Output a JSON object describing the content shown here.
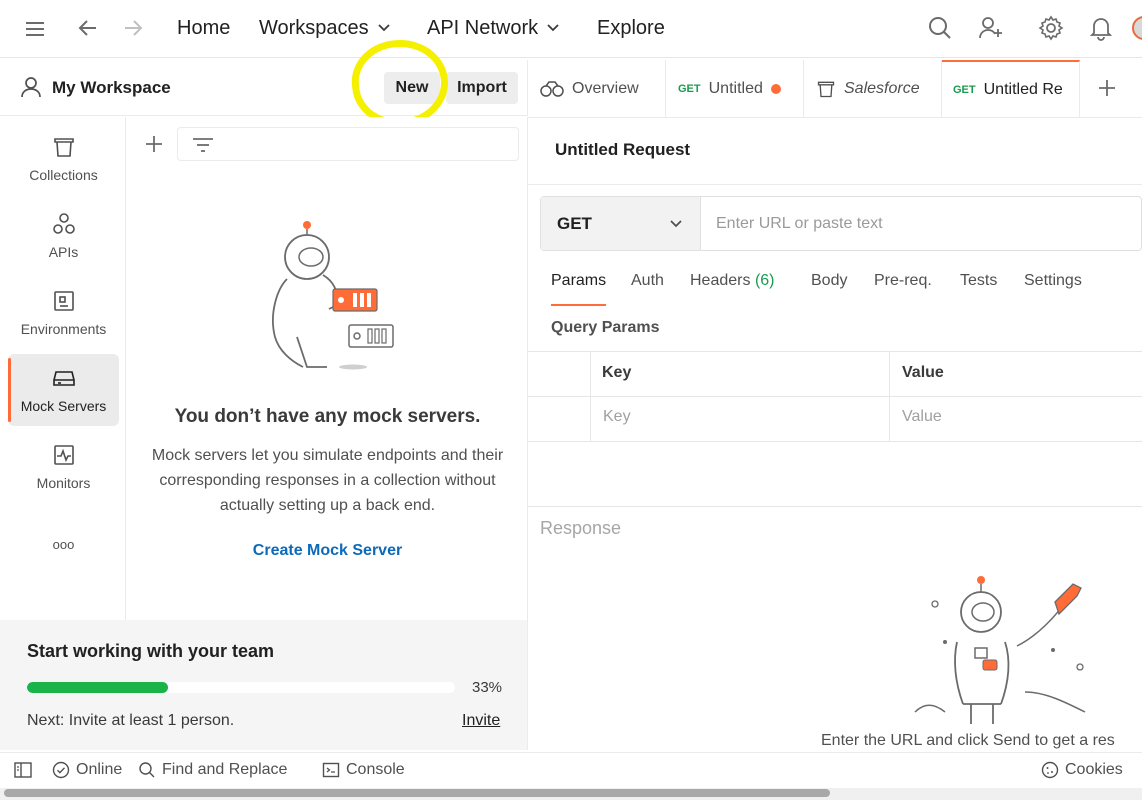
{
  "topbar": {
    "links": [
      {
        "label": "Home"
      },
      {
        "label": "Workspaces"
      },
      {
        "label": "API Network"
      },
      {
        "label": "Explore"
      }
    ]
  },
  "workspace": {
    "title": "My Workspace",
    "new_label": "New",
    "import_label": "Import"
  },
  "sidebar": {
    "items": [
      {
        "label": "Collections",
        "icon": "collections-icon"
      },
      {
        "label": "APIs",
        "icon": "apis-icon"
      },
      {
        "label": "Environments",
        "icon": "environments-icon"
      },
      {
        "label": "Mock Servers",
        "icon": "mock-servers-icon",
        "active": true
      },
      {
        "label": "Monitors",
        "icon": "monitors-icon"
      },
      {
        "label": "ooo",
        "icon": "more-icon"
      }
    ]
  },
  "mock_panel": {
    "empty_title": "You don’t have any mock servers.",
    "empty_desc": "Mock servers let you simulate endpoints and their corresponding responses in a collection without actually setting up a back end.",
    "create_label": "Create Mock Server"
  },
  "team": {
    "title": "Start working with your team",
    "progress_percent": 33,
    "progress_label": "33%",
    "next_text": "Next: Invite at least 1 person.",
    "invite_label": "Invite"
  },
  "tabs": [
    {
      "label": "Overview"
    },
    {
      "method": "GET",
      "label": "Untitled",
      "unsaved": true
    },
    {
      "label": "Salesforce"
    },
    {
      "method": "GET",
      "label": "Untitled Re",
      "active": true
    }
  ],
  "request": {
    "title": "Untitled Request",
    "method": "GET",
    "url_placeholder": "Enter URL or paste text",
    "tabs": [
      {
        "label": "Params",
        "active": true
      },
      {
        "label": "Auth"
      },
      {
        "label": "Headers",
        "count": "(6)"
      },
      {
        "label": "Body"
      },
      {
        "label": "Pre-req."
      },
      {
        "label": "Tests"
      },
      {
        "label": "Settings"
      }
    ],
    "query_params_title": "Query Params",
    "table": {
      "headers": [
        "Key",
        "Value"
      ],
      "placeholders": [
        "Key",
        "Value"
      ]
    }
  },
  "response": {
    "label": "Response",
    "hint": "Enter the URL and click Send to get a res"
  },
  "statusbar": {
    "online": "Online",
    "find_replace": "Find and Replace",
    "console": "Console",
    "cookies": "Cookies"
  },
  "colors": {
    "accent": "#ff6c37",
    "link": "#0c6ab8",
    "progress": "#19b34a",
    "highlight": "#f5f000",
    "method_green": "#1a9c4e"
  }
}
